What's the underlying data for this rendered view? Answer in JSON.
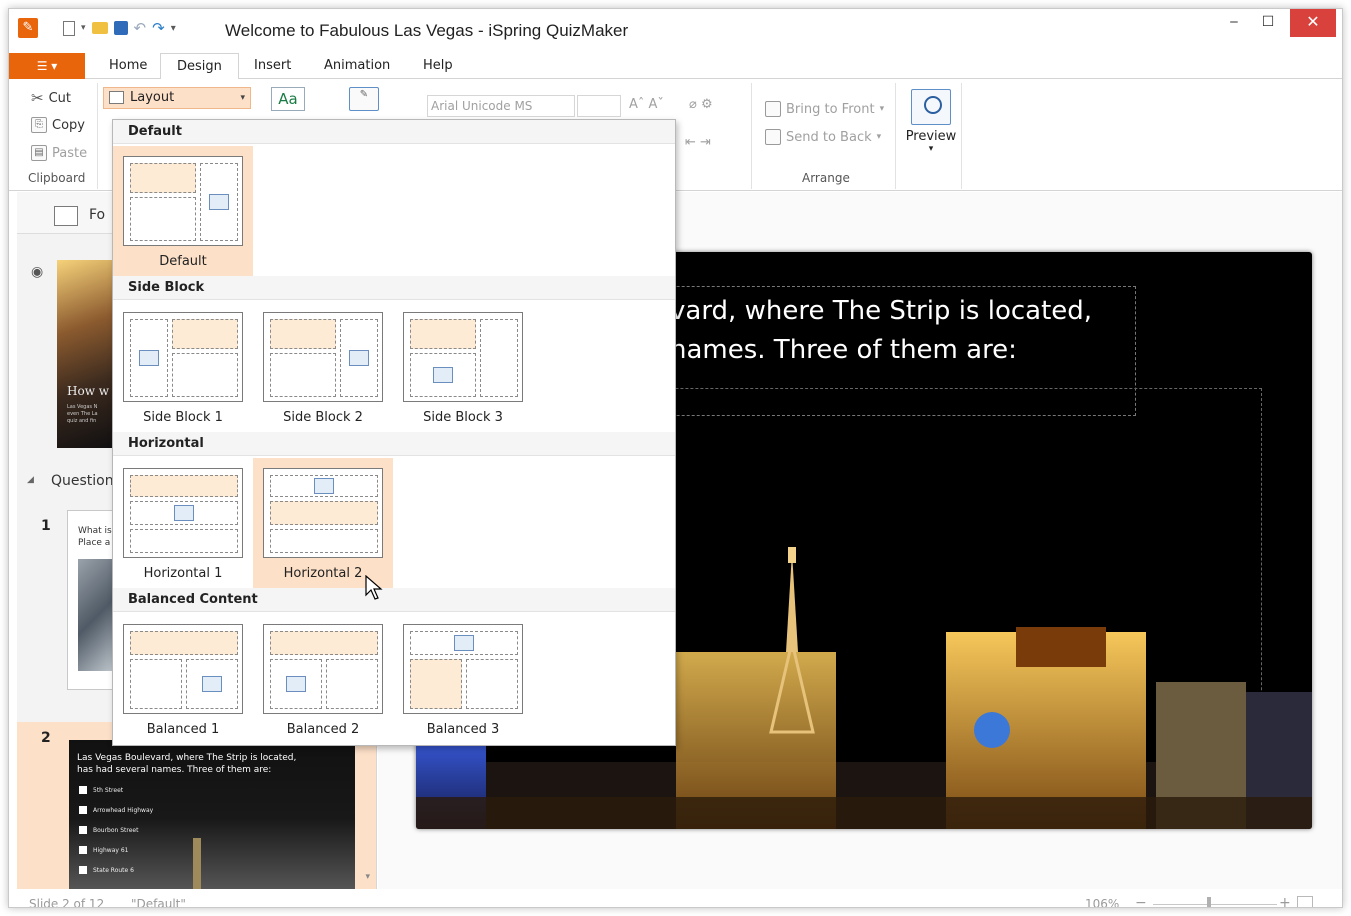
{
  "window": {
    "title": "Welcome to Fabulous Las Vegas - iSpring QuizMaker",
    "controls": {
      "min": "‒",
      "max": "☐",
      "close": "✕"
    }
  },
  "ribbon": {
    "file_tab": "☰ ▾",
    "tabs": [
      "Home",
      "Design",
      "Insert",
      "Animation",
      "Help"
    ],
    "active_tab": "Design",
    "clipboard": {
      "cut": "Cut",
      "copy": "Copy",
      "paste": "Paste",
      "group": "Clipboard"
    },
    "layout_button": "Layout",
    "theme_button": "Aa",
    "font_family": "Arial Unicode MS",
    "arrange": {
      "bring_to_front": "Bring to Front",
      "send_to_back": "Send to Back",
      "group": "Arrange"
    },
    "preview": "Preview"
  },
  "layout_menu": {
    "sections": [
      {
        "name": "Default",
        "items": [
          "Default"
        ]
      },
      {
        "name": "Side Block",
        "items": [
          "Side Block 1",
          "Side Block 2",
          "Side Block 3"
        ]
      },
      {
        "name": "Horizontal",
        "items": [
          "Horizontal 1",
          "Horizontal 2"
        ]
      },
      {
        "name": "Balanced Content",
        "items": [
          "Balanced 1",
          "Balanced 2",
          "Balanced 3"
        ]
      }
    ],
    "selected": "Default",
    "hovered": "Horizontal 2"
  },
  "left_panel": {
    "header_label": "Fo",
    "intro_slide": {
      "title": "How w",
      "text": "Las Vegas N\neven The La\nquiz and fin"
    },
    "question_group": "Question",
    "slides": [
      {
        "num": "1",
        "text": "What is\nPlace a"
      },
      {
        "num": "2",
        "text": "Las Vegas Boulevard, where The Strip is located,\nhas had several names. Three of them are:",
        "options": [
          "5th Street",
          "Arrowhead Highway",
          "Bourbon Street",
          "Highway 61",
          "State Route 6"
        ]
      }
    ]
  },
  "slide": {
    "text": "vard, where The Strip is located,\nnames. Three of them are:"
  },
  "statusbar": {
    "slide_info": "Slide 2 of 12",
    "layout": "\"Default\"",
    "zoom": "106%"
  }
}
